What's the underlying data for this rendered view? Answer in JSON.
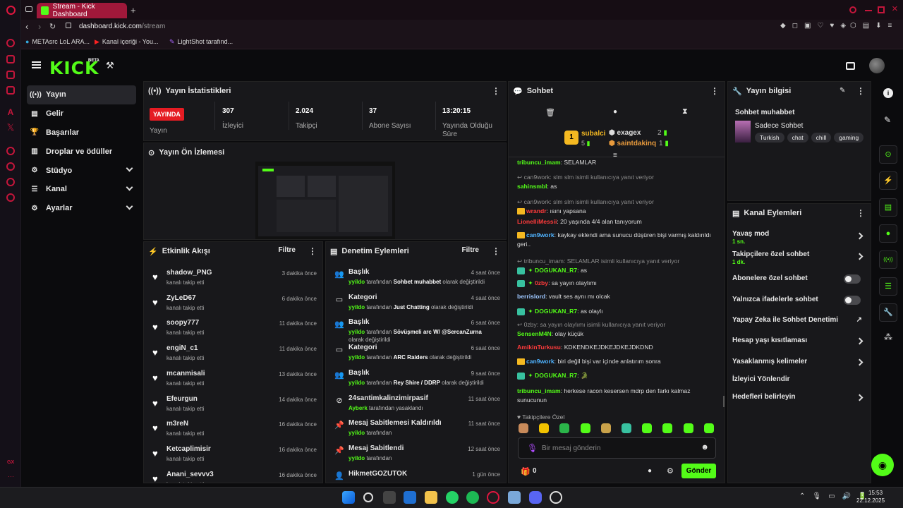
{
  "browser": {
    "tab_title": "Stream - Kick Dashboard",
    "url_host": "dashboard.kick.com",
    "url_path": "/stream",
    "bookmarks": [
      "METAsrc LoL ARA...",
      "Kanal içeriği - You...",
      "LightShot tarafınd..."
    ]
  },
  "header": {
    "logo": "KICK",
    "beta": "BETA"
  },
  "nav": {
    "items": [
      {
        "label": "Yayın",
        "icon": "((•))",
        "active": true
      },
      {
        "label": "Gelir",
        "icon": "▤"
      },
      {
        "label": "Başarılar",
        "icon": "🏆"
      },
      {
        "label": "Droplar ve ödüller",
        "icon": "▥"
      },
      {
        "label": "Stüdyo",
        "icon": "⚙",
        "chevron": true
      },
      {
        "label": "Kanal",
        "icon": "☰",
        "chevron": true
      },
      {
        "label": "Ayarlar",
        "icon": "⚙",
        "chevron": true
      }
    ]
  },
  "stats": {
    "title": "Yayın İstatistikleri",
    "live_badge": "YAYINDA",
    "live_label": "Yayın",
    "items": [
      {
        "value": "307",
        "label": "İzleyici"
      },
      {
        "value": "2.024",
        "label": "Takipçi"
      },
      {
        "value": "37",
        "label": "Abone Sayısı"
      },
      {
        "value": "13:20:15",
        "label": "Yayında Olduğu Süre"
      }
    ]
  },
  "preview": {
    "title": "Yayın Ön İzlemesi"
  },
  "activity": {
    "title": "Etkinlik Akışı",
    "filter": "Filtre",
    "items": [
      {
        "name": "shadow_PNG",
        "sub": "kanalı takip etti",
        "time": "3 dakika önce"
      },
      {
        "name": "ZyLeD67",
        "sub": "kanalı takip etti",
        "time": "6 dakika önce"
      },
      {
        "name": "soopy777",
        "sub": "kanalı takip etti",
        "time": "11 dakika önce"
      },
      {
        "name": "engiN_c1",
        "sub": "kanalı takip etti",
        "time": "11 dakika önce"
      },
      {
        "name": "mcanmisali",
        "sub": "kanalı takip etti",
        "time": "13 dakika önce"
      },
      {
        "name": "Efeurgun",
        "sub": "kanalı takip etti",
        "time": "14 dakika önce"
      },
      {
        "name": "m3reN",
        "sub": "kanalı takip etti",
        "time": "16 dakika önce"
      },
      {
        "name": "Ketcaplimisir",
        "sub": "kanalı takip etti",
        "time": "16 dakika önce"
      },
      {
        "name": "Anani_sevvv3",
        "sub": "kanalı takip etti",
        "time": "16 dakika önce"
      }
    ]
  },
  "moderation": {
    "title": "Denetim Eylemleri",
    "filter": "Filtre",
    "items": [
      {
        "name": "Başlık",
        "time": "4 saat önce",
        "user": "yyildo",
        "pre": " tarafından ",
        "val": "Sohbet muhabbet",
        "post": " olarak değiştirildi"
      },
      {
        "name": "Kategori",
        "time": "4 saat önce",
        "user": "yyildo",
        "pre": " tarafından ",
        "val": "Just Chatting",
        "post": " olarak değiştirildi"
      },
      {
        "name": "Başlık",
        "time": "6 saat önce",
        "user": "yyildo",
        "pre": " tarafından ",
        "val": "Sövüşmeli arc W/ @SercanZurna",
        "post": " olarak değiştirildi"
      },
      {
        "name": "Kategori",
        "time": "6 saat önce",
        "user": "yyildo",
        "pre": " tarafından ",
        "val": "ARC Raiders",
        "post": " olarak değiştirildi"
      },
      {
        "name": "Başlık",
        "time": "9 saat önce",
        "user": "yyildo",
        "pre": " tarafından ",
        "val": "Rey Shire / DDRP",
        "post": " olarak değiştirildi"
      },
      {
        "name": "24santimkalinzimirpasif",
        "time": "11 saat önce",
        "user": "Ayberk",
        "pre": " tarafından yasaklandı",
        "val": "",
        "post": ""
      },
      {
        "name": "Mesaj Sabitlemesi Kaldırıldı",
        "time": "11 saat önce",
        "user": "yyildo",
        "pre": " tarafından",
        "val": "",
        "post": ""
      },
      {
        "name": "Mesaj Sabitlendi",
        "time": "12 saat önce",
        "user": "yyildo",
        "pre": " tarafından",
        "val": "",
        "post": ""
      },
      {
        "name": "HikmetGOZUTOK",
        "time": "1 gün önce",
        "user": "",
        "pre": "",
        "val": "",
        "post": ""
      }
    ]
  },
  "chat": {
    "title": "Sohbet",
    "top": [
      {
        "name": "subalci",
        "count": "5",
        "rank": "1"
      },
      {
        "name": "exagex",
        "count": "2"
      },
      {
        "name": "saintdakinq",
        "count": "1"
      }
    ],
    "messages": [
      {
        "user": "tribuncu_imam",
        "text": "SELAMLAR",
        "color": "#53fc18"
      },
      {
        "reply": "can9work: slm slm isimli kullanıcıya yanıt veriyor",
        "user": "sahinsmbl",
        "text": "as",
        "color": "#53fc18"
      },
      {
        "reply": "can9work: slm slm isimli kullanıcıya yanıt veriyor",
        "user": "wrandr",
        "text": "ısını yapsana",
        "color": "#ff3b3b",
        "badge": "crown"
      },
      {
        "user": "LionelliMessii",
        "text": "20 yaşında 4/4 alan tanıyorum",
        "color": "#ff3b3b"
      },
      {
        "user": "can9work",
        "text": "kaykay eklendi ama sunucu düşüren bişi varmış kaldırıldı geri..",
        "color": "#4fb3ff",
        "badge": "crown"
      },
      {
        "reply": "tribuncu_imam: SELAMLAR isimli kullanıcıya yanıt veriyor",
        "user": "DOGUKAN_R7",
        "text": "as",
        "color": "#53fc18",
        "badge": "gem"
      },
      {
        "user": "0zby",
        "text": "sa yayın olaylımı",
        "color": "#ff3b3b",
        "badge": "gem"
      },
      {
        "user": "berrislord",
        "text": "vault ses aynı mı olcak",
        "color": "#9ec7ff"
      },
      {
        "user": "DOGUKAN_R7",
        "text": "as olaylı",
        "color": "#53fc18",
        "badge": "gem"
      },
      {
        "reply": "0zby: sa yayın olaylımı isimli kullanıcıya yanıt veriyor",
        "user": "SensenM4N",
        "text": "olay küçük",
        "color": "#53fc18"
      },
      {
        "user": "AmikinTurkusu",
        "text": "KDKENDKEJDKEJDKEJDKDND",
        "color": "#ff3b3b"
      },
      {
        "user": "can9work",
        "text": "biri değil bişi var içinde anlatırım sonra",
        "color": "#4fb3ff",
        "badge": "crown"
      },
      {
        "user": "DOGUKAN_R7",
        "text": "🐊",
        "color": "#53fc18",
        "badge": "gem"
      },
      {
        "user": "tribuncu_imam",
        "text": "herkese racon kesersen mdrp den farkı kalmaz sunucunun",
        "color": "#53fc18"
      }
    ],
    "followers_only": "Takipçilere Özel",
    "input_placeholder": "Bir mesaj gönderin",
    "points": "0",
    "send": "Gönder"
  },
  "streaminfo": {
    "title": "Yayın bilgisi",
    "stream_title": "Sohbet muhabbet",
    "category": "Sadece Sohbet",
    "tags": [
      "Turkish",
      "chat",
      "chill",
      "gaming"
    ]
  },
  "channel_actions": {
    "title": "Kanal Eylemleri",
    "items": [
      {
        "label": "Yavaş mod",
        "sub": "1 sn.",
        "type": "arrow"
      },
      {
        "label": "Takipçilere özel sohbet",
        "sub": "1 dk.",
        "type": "arrow"
      },
      {
        "label": "Abonelere özel sohbet",
        "type": "toggle"
      },
      {
        "label": "Yalnızca ifadelerle sohbet",
        "type": "toggle"
      },
      {
        "label": "Yapay Zeka ile Sohbet Denetimi",
        "type": "external"
      },
      {
        "label": "Hesap yaşı kısıtlaması",
        "type": "arrow"
      },
      {
        "label": "Yasaklanmış kelimeler",
        "type": "arrow"
      },
      {
        "label": "İzleyici Yönlendir",
        "type": "none"
      },
      {
        "label": "Hedefleri belirleyin",
        "type": "arrow"
      }
    ]
  },
  "taskbar": {
    "time": "15:53",
    "date": "22.12.2025"
  }
}
